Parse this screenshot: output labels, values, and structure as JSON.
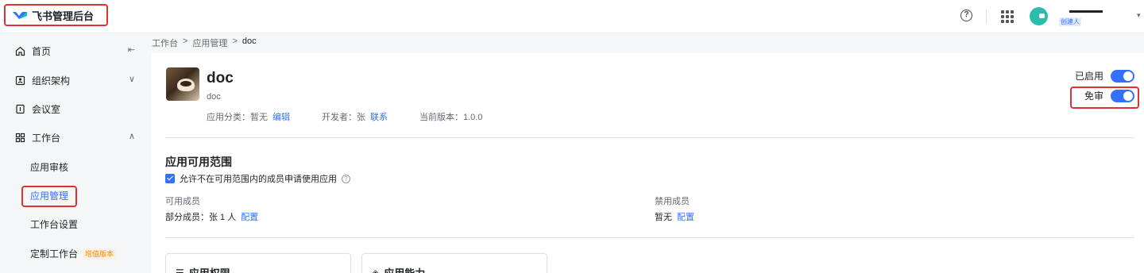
{
  "header": {
    "logo_text": "飞书管理后台",
    "help_icon": "?",
    "user_role": "创建人",
    "caret": "▾"
  },
  "sidebar": {
    "collapse_icon": "⇤",
    "items": [
      {
        "label": "首页",
        "icon": "home-icon"
      },
      {
        "label": "组织架构",
        "icon": "org-icon",
        "chevron": "∨"
      },
      {
        "label": "会议室",
        "icon": "meeting-room-icon"
      },
      {
        "label": "工作台",
        "icon": "workspace-icon",
        "chevron": "∧"
      }
    ],
    "sub_items": [
      {
        "label": "应用审核"
      },
      {
        "label": "应用管理"
      },
      {
        "label": "工作台设置"
      },
      {
        "label": "定制工作台",
        "badge": "增值版本"
      }
    ]
  },
  "breadcrumb": [
    "工作台",
    ">",
    "应用管理",
    ">",
    "doc"
  ],
  "app": {
    "name": "doc",
    "description": "doc",
    "category_label": "应用分类：暂无",
    "category_action": "编辑",
    "developer_label": "开发者：张",
    "developer_action": "联系",
    "version_label": "当前版本：1.0.0"
  },
  "toggles": {
    "enabled_label": "已启用",
    "enabled": true,
    "exempt_label": "免审",
    "exempt": true
  },
  "scope": {
    "title": "应用可用范围",
    "allow_request_label": "允许不在可用范围内的成员申请使用应用",
    "allow_request_checked": true,
    "available_title": "可用成员",
    "available_value": "部分成员：张 1 人",
    "available_action": "配置",
    "disabled_title": "禁用成员",
    "disabled_value": "暂无",
    "disabled_action": "配置"
  },
  "cards": [
    {
      "label": "应用权限",
      "icon": "list-icon"
    },
    {
      "label": "应用能力",
      "icon": "layers-icon"
    }
  ],
  "colors": {
    "accent": "#3370ff",
    "highlight_box": "#e03030",
    "badge": "#ff8800"
  }
}
